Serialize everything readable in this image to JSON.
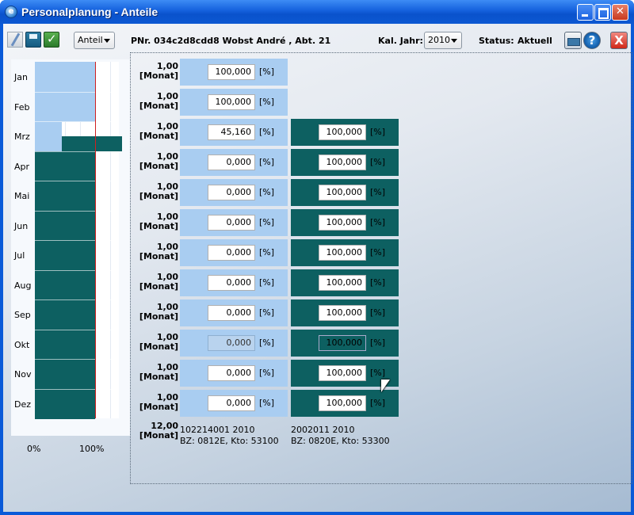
{
  "window": {
    "title": "Personalplanung - Anteile"
  },
  "toolbar": {
    "mode_combo": "Anteil",
    "person_info": "PNr. 034c2d8cdd8 Wobst André , Abt. 21",
    "year_label": "Kal. Jahr:",
    "year_value": "2010",
    "status_label": "Status:",
    "status_value": "Aktuell",
    "help_glyph": "?",
    "close_glyph": "X"
  },
  "chart_data": {
    "type": "bar",
    "orientation": "horizontal-stacked",
    "categories": [
      "Jan",
      "Feb",
      "Mrz",
      "Apr",
      "Mai",
      "Jun",
      "Jul",
      "Aug",
      "Sep",
      "Okt",
      "Nov",
      "Dez"
    ],
    "series": [
      {
        "values": [
          100,
          100,
          45.16,
          0,
          0,
          0,
          0,
          0,
          0,
          0,
          0,
          0
        ],
        "color": "#a9cdf1"
      },
      {
        "values": [
          0,
          0,
          100,
          100,
          100,
          100,
          100,
          100,
          100,
          100,
          100,
          100
        ],
        "color": "#0d6061"
      }
    ],
    "x_tick_labels": [
      "0%",
      "100%"
    ],
    "xlim": [
      0,
      140
    ],
    "reference_line": 100
  },
  "rows": [
    {
      "unit_value": "1,00",
      "unit_label": "[Monat]",
      "a": "100,000",
      "b": null,
      "a_disabled": false,
      "b_disabled": false
    },
    {
      "unit_value": "1,00",
      "unit_label": "[Monat]",
      "a": "100,000",
      "b": null,
      "a_disabled": false,
      "b_disabled": false
    },
    {
      "unit_value": "1,00",
      "unit_label": "[Monat]",
      "a": "45,160",
      "b": "100,000",
      "a_disabled": false,
      "b_disabled": false
    },
    {
      "unit_value": "1,00",
      "unit_label": "[Monat]",
      "a": "0,000",
      "b": "100,000",
      "a_disabled": false,
      "b_disabled": false
    },
    {
      "unit_value": "1,00",
      "unit_label": "[Monat]",
      "a": "0,000",
      "b": "100,000",
      "a_disabled": false,
      "b_disabled": false
    },
    {
      "unit_value": "1,00",
      "unit_label": "[Monat]",
      "a": "0,000",
      "b": "100,000",
      "a_disabled": false,
      "b_disabled": false
    },
    {
      "unit_value": "1,00",
      "unit_label": "[Monat]",
      "a": "0,000",
      "b": "100,000",
      "a_disabled": false,
      "b_disabled": false
    },
    {
      "unit_value": "1,00",
      "unit_label": "[Monat]",
      "a": "0,000",
      "b": "100,000",
      "a_disabled": false,
      "b_disabled": false
    },
    {
      "unit_value": "1,00",
      "unit_label": "[Monat]",
      "a": "0,000",
      "b": "100,000",
      "a_disabled": false,
      "b_disabled": false
    },
    {
      "unit_value": "1,00",
      "unit_label": "[Monat]",
      "a": "0,000",
      "b": "100,000",
      "a_disabled": true,
      "b_disabled": true
    },
    {
      "unit_value": "1,00",
      "unit_label": "[Monat]",
      "a": "0,000",
      "b": "100,000",
      "a_disabled": false,
      "b_disabled": false
    },
    {
      "unit_value": "1,00",
      "unit_label": "[Monat]",
      "a": "0,000",
      "b": "100,000",
      "a_disabled": false,
      "b_disabled": false
    }
  ],
  "percent_unit": "[%]",
  "total": {
    "value": "12,00",
    "label": "[Monat]"
  },
  "columns": [
    {
      "line1": "102214001 2010",
      "line2": "BZ: 0812E, Kto: 53100"
    },
    {
      "line1": "2002011 2010",
      "line2": "BZ: 0820E, Kto: 53300"
    }
  ]
}
